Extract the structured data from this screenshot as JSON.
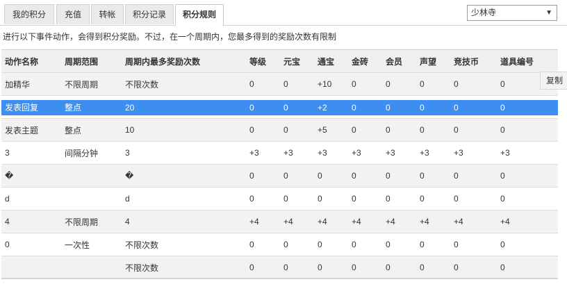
{
  "tabs": [
    {
      "label": "我的积分"
    },
    {
      "label": "充值"
    },
    {
      "label": "转帐"
    },
    {
      "label": "积分记录"
    },
    {
      "label": "积分规则",
      "active": true
    }
  ],
  "forum_select": {
    "value": "少林寺"
  },
  "notice": "进行以下事件动作，会得到积分奖励。不过，在一个周期内，您最多得到的奖励次数有限制",
  "table": {
    "headers": [
      "动作名称",
      "周期范围",
      "周期内最多奖励次数",
      "等级",
      "元宝",
      "通宝",
      "金砖",
      "会员",
      "声望",
      "竞技币",
      "道具编号"
    ],
    "rows": [
      [
        "加精华",
        "不限周期",
        "不限次数",
        "0",
        "0",
        "+10",
        "0",
        "0",
        "0",
        "0",
        "0"
      ],
      [
        "发表回复",
        "整点",
        "20",
        "0",
        "0",
        "+2",
        "0",
        "0",
        "0",
        "0",
        "0"
      ],
      [
        "发表主题",
        "整点",
        "10",
        "0",
        "0",
        "+5",
        "0",
        "0",
        "0",
        "0",
        "0"
      ],
      [
        "3",
        "间隔分钟",
        "3",
        "+3",
        "+3",
        "+3",
        "+3",
        "+3",
        "+3",
        "+3",
        "+3"
      ],
      [
        "�",
        "",
        "�",
        "0",
        "0",
        "0",
        "0",
        "0",
        "0",
        "0",
        "0"
      ],
      [
        "d",
        "",
        "d",
        "0",
        "0",
        "0",
        "0",
        "0",
        "0",
        "0",
        "0"
      ],
      [
        "4",
        "不限周期",
        "4",
        "+4",
        "+4",
        "+4",
        "+4",
        "+4",
        "+4",
        "+4",
        "+4"
      ],
      [
        "0",
        "一次性",
        "不限次数",
        "0",
        "0",
        "0",
        "0",
        "0",
        "0",
        "0",
        "0"
      ],
      [
        "",
        "",
        "不限次数",
        "0",
        "0",
        "0",
        "0",
        "0",
        "0",
        "0",
        "0"
      ]
    ],
    "selected_row": 1
  },
  "copy_button": "复制",
  "colors": {
    "selection": "#3d8ef0",
    "row_alt": "#f2f2f2",
    "header": "#f0f0f0"
  }
}
